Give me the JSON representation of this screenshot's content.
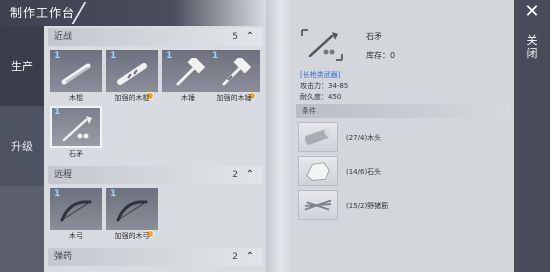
{
  "window": {
    "title": "制作工作台"
  },
  "tabs": [
    {
      "label": "生产",
      "active": true
    },
    {
      "label": "升级",
      "active": false
    }
  ],
  "sections": [
    {
      "title": "近战",
      "count": "5",
      "items": [
        {
          "qty": "1",
          "name": "木棍",
          "icon": "wooden-stick-icon",
          "enhanced": false
        },
        {
          "qty": "1",
          "name": "加强的木棍",
          "icon": "reinforced-wooden-stick-icon",
          "enhanced": true
        },
        {
          "qty": "1",
          "name": "木锤",
          "icon": "wooden-hammer-icon",
          "enhanced": false
        },
        {
          "qty": "1",
          "name": "加强的木锤",
          "icon": "reinforced-wooden-hammer-icon",
          "enhanced": true
        },
        {
          "qty": "1",
          "name": "石矛",
          "icon": "stone-spear-icon",
          "enhanced": false,
          "selected": true
        }
      ]
    },
    {
      "title": "远程",
      "count": "2",
      "items": [
        {
          "qty": "1",
          "name": "木弓",
          "icon": "wooden-bow-icon",
          "enhanced": false
        },
        {
          "qty": "1",
          "name": "加强的木弓",
          "icon": "reinforced-wooden-bow-icon",
          "enhanced": true
        }
      ]
    },
    {
      "title": "弹药",
      "count": "2",
      "items": []
    }
  ],
  "detail": {
    "name": "石矛",
    "stock": "库存：0",
    "type": "[长枪类武器]",
    "attack": "攻击力：34-85",
    "durability": "耐久度：450",
    "materials_title": "条件",
    "materials": [
      {
        "icon": "wood-log-icon",
        "text": "(27/4)木头"
      },
      {
        "icon": "stone-icon",
        "text": "(14/6)石头"
      },
      {
        "icon": "boar-tendon-icon",
        "text": "(15/2)野猪筋"
      }
    ]
  },
  "close": {
    "label": "关闭"
  },
  "colors": {
    "qty": "#9ed6ff",
    "type_link": "#2f6fd1",
    "enhanced_badge": "#e8a53a",
    "panel_dark": "#484c58"
  }
}
